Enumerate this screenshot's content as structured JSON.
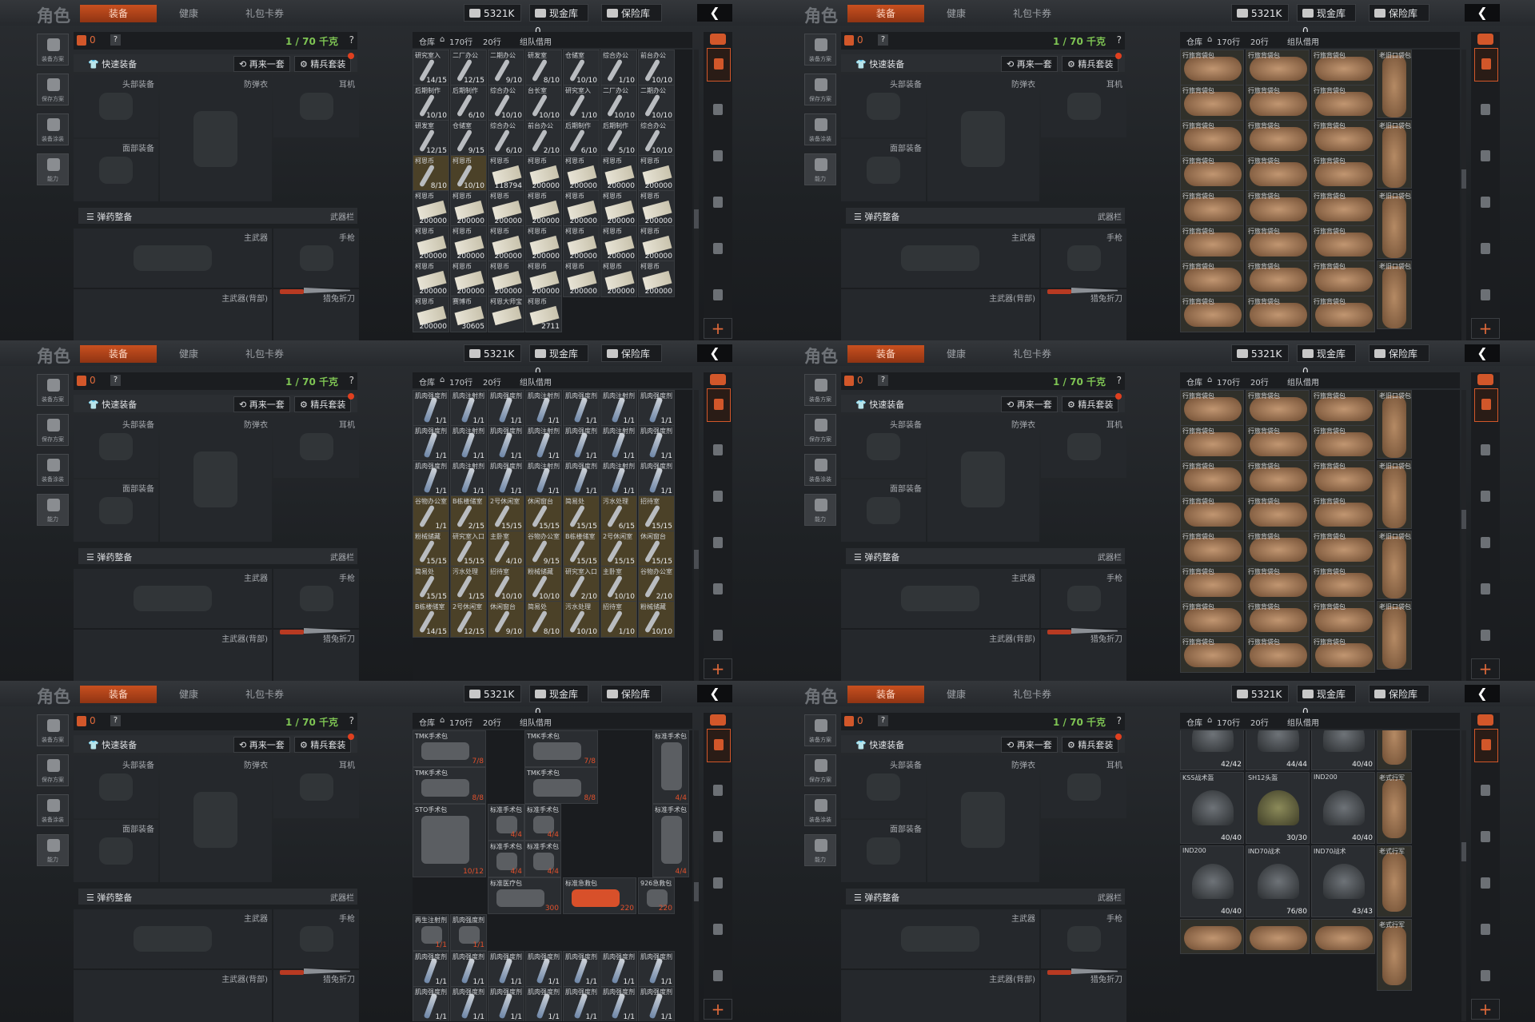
{
  "header": {
    "title": "角色",
    "tabs": [
      {
        "label": "装备",
        "active": true
      },
      {
        "label": "健康",
        "active": false
      },
      {
        "label": "礼包卡券",
        "active": false
      }
    ],
    "currency": "5321K",
    "cash_vault": "现金库 0",
    "safe_vault": "保险库"
  },
  "sidebar": [
    "装备方案",
    "保存方案",
    "装备涂装",
    "能力"
  ],
  "equipment": {
    "weight": "0",
    "help": "?",
    "capacity": "1 / 70 千克",
    "quick_equip": "快速装备",
    "again": "再来一套",
    "elite": "精兵套装",
    "head": "头部装备",
    "armor": "防弹衣",
    "ear": "耳机",
    "face": "面部装备",
    "ammo": "弹药整备",
    "weapon_bar": "武器栏",
    "primary": "主武器",
    "pistol": "手枪",
    "primary_back": "主武器(背部)",
    "knife": "猎兔折刀"
  },
  "storage": {
    "label": "仓库",
    "rows": "170行",
    "cols": "20行",
    "team": "组队借用"
  },
  "colors": {
    "accent": "#d2572a",
    "capacity_green": "#7ec453"
  },
  "panels": [
    {
      "kind": "mixed",
      "cells": [
        [
          "14/15",
          "12/15",
          "9/10",
          "8/10",
          "10/10",
          "1/10",
          "10/10"
        ],
        [
          "10/10",
          "6/10",
          "10/10",
          "10/10",
          "1/10",
          "10/10",
          "10/10"
        ],
        [
          "12/15",
          "9/15",
          "6/10",
          "2/10",
          "6/10",
          "5/10",
          "10/10"
        ],
        [
          "8/10",
          "10/10",
          "118794",
          "200000",
          "200000",
          "200000",
          "200000"
        ],
        [
          "200000",
          "200000",
          "200000",
          "200000",
          "200000",
          "200000",
          "200000"
        ],
        [
          "200000",
          "200000",
          "200000",
          "200000",
          "200000",
          "200000",
          "200000"
        ],
        [
          "200000",
          "200000",
          "200000",
          "200000",
          "200000",
          "200000",
          "200000"
        ],
        [
          "200000",
          "30605",
          "",
          "2711"
        ]
      ],
      "names": [
        "研究室入",
        "二厂办公",
        "二期办公",
        "研发室",
        "仓储室",
        "综合办公",
        "前台办公",
        "后期制作",
        "后期制作",
        "综合办公",
        "台长室",
        "柯恩币",
        "赛博币",
        "柯恩大师宝"
      ]
    },
    {
      "kind": "bags",
      "cells": [
        "行旅背袋包",
        "行旅背袋包",
        "行旅背袋包",
        "老旧口袋包"
      ],
      "tail": "TMK手术包"
    },
    {
      "kind": "syringes",
      "cells": [
        [
          "1/1",
          "1/1",
          "1/1",
          "1/1",
          "1/1",
          "1/1",
          "1/1"
        ],
        [
          "1/1",
          "1/1",
          "1/1",
          "1/1",
          "1/1",
          "1/1",
          "1/1"
        ],
        [
          "1/1",
          "1/1",
          "1/1",
          "1/1",
          "1/1",
          "1/1",
          "1/1"
        ],
        [
          "1/1",
          "2/15",
          "15/15",
          "15/15",
          "15/15",
          "6/15",
          "15/15"
        ],
        [
          "15/15",
          "15/15",
          "4/10",
          "9/15",
          "15/15",
          "15/15",
          "15/15"
        ],
        [
          "15/15",
          "1/15",
          "10/10",
          "10/10",
          "2/10",
          "10/10",
          "2/10"
        ],
        [
          "14/15",
          "12/15",
          "9/10",
          "8/10",
          "10/10",
          "1/10",
          "10/10"
        ]
      ],
      "names": [
        "肌肉强度剂",
        "肌肉注射剂",
        "主卧室",
        "谷物办公室",
        "B栋楼储室",
        "2号休闲室",
        "休闲窗台",
        "简易处",
        "污水处理",
        "招待室",
        "粉械储藏",
        "研究室入口"
      ]
    },
    {
      "kind": "bags",
      "cells": [
        "行旅背袋包",
        "行旅背袋包",
        "行旅背袋包",
        "老旧口袋包"
      ],
      "tail": ""
    },
    {
      "kind": "medical",
      "items": [
        {
          "name": "TMK手术包",
          "count": "7/8"
        },
        {
          "name": "TMK手术包",
          "count": "7/8"
        },
        {
          "name": "TMK手术包",
          "count": "8/8"
        },
        {
          "name": "TMK手术包",
          "count": "8/8"
        },
        {
          "name": "STO手术包",
          "count": "10/12"
        },
        {
          "name": "标准手术包",
          "count": "4/4"
        },
        {
          "name": "标准手术包",
          "count": "4/4"
        },
        {
          "name": "标准手术包",
          "count": "4/4"
        },
        {
          "name": "标准手术包",
          "count": "4/4"
        },
        {
          "name": "标准手术包",
          "count": "4/4"
        },
        {
          "name": "标准手术包",
          "count": "4/4"
        },
        {
          "name": "标准医疗包",
          "count": "300"
        },
        {
          "name": "标准急救包",
          "count": "220"
        },
        {
          "name": "926急救包",
          "count": "220"
        },
        {
          "name": "再生注射剂",
          "count": "1/1"
        },
        {
          "name": "肌肉强度剂",
          "count": "1/1"
        }
      ]
    },
    {
      "kind": "helmets",
      "items": [
        {
          "name": "",
          "count": "42/42"
        },
        {
          "name": "",
          "count": "44/44"
        },
        {
          "name": "",
          "count": "40/40"
        },
        {
          "name": "KSS战术盔",
          "count": "40/40"
        },
        {
          "name": "SH12头盔",
          "count": "30/30"
        },
        {
          "name": "IND200",
          "count": "40/40"
        },
        {
          "name": "IND200",
          "count": "40/40"
        },
        {
          "name": "IND70战术",
          "count": "76/80"
        },
        {
          "name": "IND70战术",
          "count": "43/43"
        },
        {
          "name": "老式行军",
          "count": ""
        }
      ]
    }
  ]
}
